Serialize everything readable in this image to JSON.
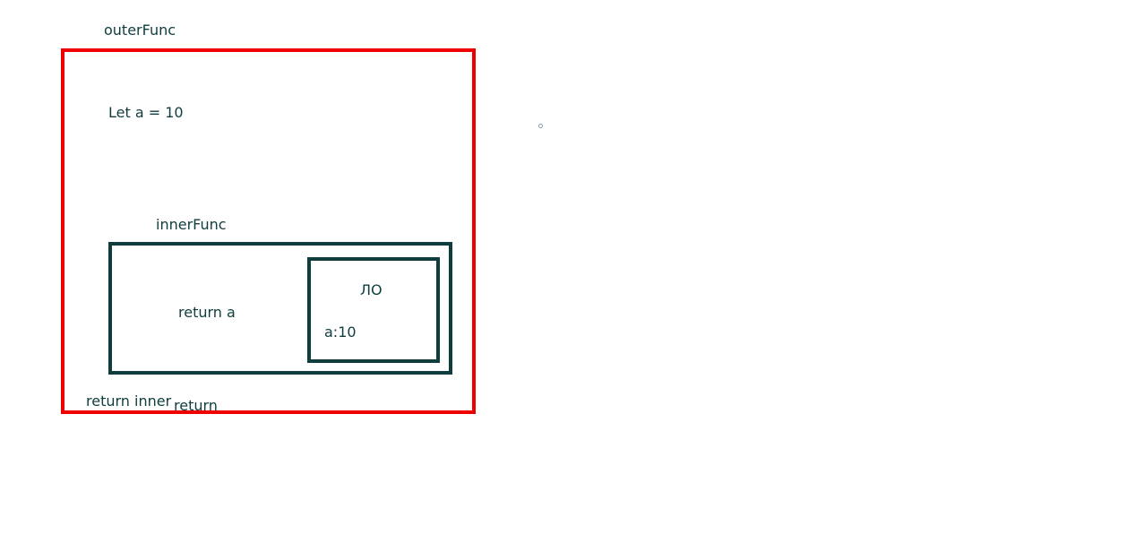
{
  "colors": {
    "outer_box": "#ee0000",
    "inner_box": "#0f3d3d",
    "text": "#0f3d3d"
  },
  "outer": {
    "title": "outerFunc",
    "declaration": "Let a = 10",
    "return_label": "return inner",
    "return_overlap_label": "return"
  },
  "inner": {
    "title": "innerFunc",
    "return_label": "return a"
  },
  "lexical_env": {
    "title": "ЛО",
    "binding": "a:10"
  }
}
